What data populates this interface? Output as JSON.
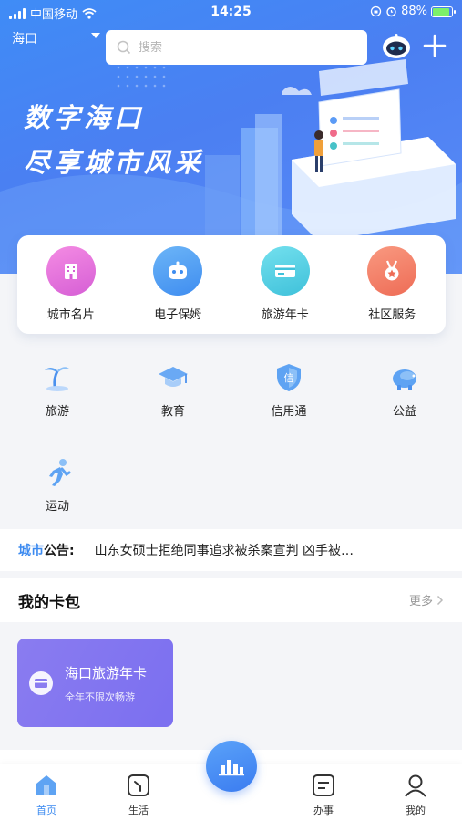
{
  "status_bar": {
    "carrier": "中国移动",
    "time": "14:25",
    "battery": "88%"
  },
  "header": {
    "city": "海口",
    "search_placeholder": "搜索"
  },
  "banner": {
    "line1": "数字海口",
    "line2": "尽享城市风采"
  },
  "main_services": [
    {
      "label": "城市名片",
      "icon": "building-icon",
      "color": "#e86bd8"
    },
    {
      "label": "电子保姆",
      "icon": "robot-icon",
      "color": "#4a9cf2"
    },
    {
      "label": "旅游年卡",
      "icon": "card-icon",
      "color": "#4fd0e0"
    },
    {
      "label": "社区服务",
      "icon": "medal-icon",
      "color": "#f47b63"
    }
  ],
  "grid_services": [
    {
      "label": "旅游",
      "icon": "palm-tree-icon"
    },
    {
      "label": "教育",
      "icon": "graduation-cap-icon"
    },
    {
      "label": "信用通",
      "icon": "credit-shield-icon"
    },
    {
      "label": "公益",
      "icon": "piggy-bank-icon"
    },
    {
      "label": "运动",
      "icon": "running-icon"
    }
  ],
  "notice": {
    "tag_prefix": "城市",
    "tag_suffix": "公告:",
    "text": "山东女硕士拒绝同事追求被杀案宣判 凶手被…"
  },
  "wallet": {
    "title": "我的卡包",
    "more": "更多",
    "card": {
      "title": "海口旅游年卡",
      "subtitle": "全年不限次畅游"
    }
  },
  "next_section": {
    "title": "主题专区"
  },
  "tabs": [
    {
      "label": "首页",
      "icon": "home-icon",
      "active": true
    },
    {
      "label": "生活",
      "icon": "life-icon",
      "active": false
    },
    {
      "label": "办事",
      "icon": "document-icon",
      "active": false
    },
    {
      "label": "我的",
      "icon": "user-icon",
      "active": false
    }
  ],
  "accent_color": "#3d8bf0"
}
